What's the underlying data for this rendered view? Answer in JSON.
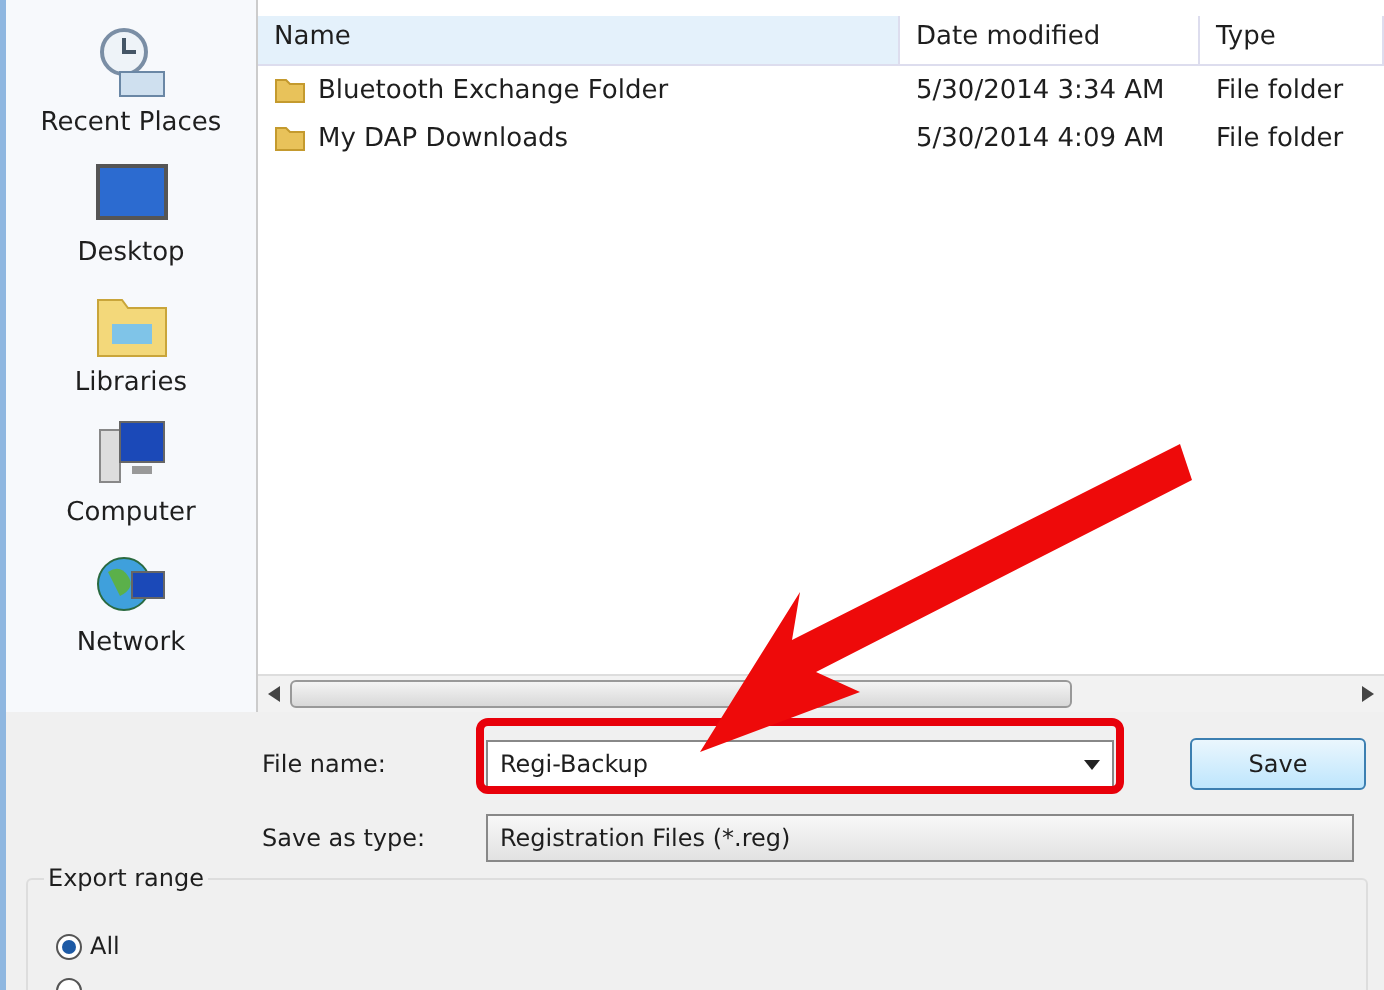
{
  "places": [
    {
      "label": "Recent Places",
      "kind": "recent"
    },
    {
      "label": "Desktop",
      "kind": "desktop"
    },
    {
      "label": "Libraries",
      "kind": "libraries"
    },
    {
      "label": "Computer",
      "kind": "computer"
    },
    {
      "label": "Network",
      "kind": "network"
    }
  ],
  "columns": [
    "Name",
    "Date modified",
    "Type"
  ],
  "files": [
    {
      "name": "Bluetooth Exchange Folder",
      "date": "5/30/2014 3:34 AM",
      "type": "File folder"
    },
    {
      "name": "My DAP Downloads",
      "date": "5/30/2014 4:09 AM",
      "type": "File folder"
    }
  ],
  "file_name": {
    "label": "File name:",
    "value": "Regi-Backup"
  },
  "save_as_type": {
    "label": "Save as type:",
    "value": "Registration Files (*.reg)"
  },
  "save_button": "Save",
  "export_range": {
    "title": "Export range",
    "options": [
      {
        "label": "All",
        "selected": true
      },
      {
        "selected": false
      }
    ]
  }
}
